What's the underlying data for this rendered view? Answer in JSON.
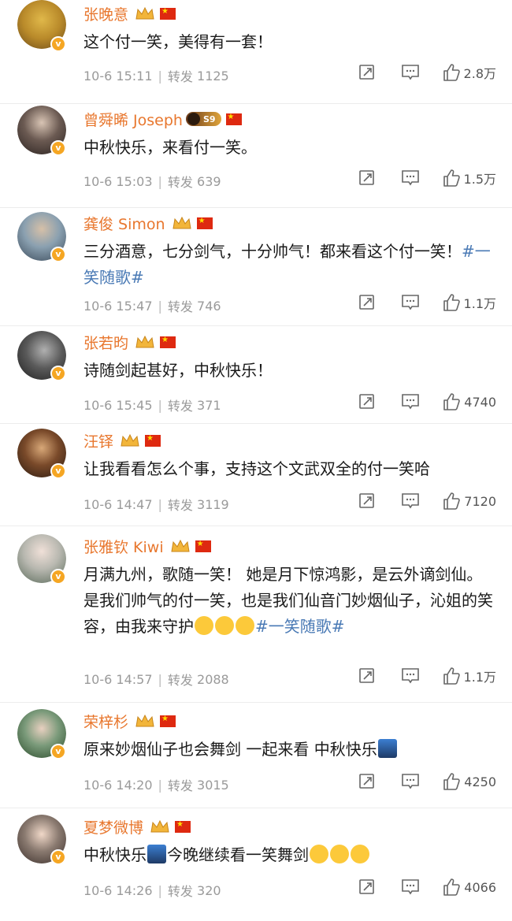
{
  "repost_label": "转发",
  "comments": [
    {
      "name": "张晚意",
      "text": "这个付一笑，美得有一套！",
      "tag": "",
      "time": "10-6 15:11",
      "reposts": "1125",
      "likes": "2.8万"
    },
    {
      "name": "曾舜晞 Joseph",
      "badge": "S9",
      "text": "中秋快乐，来看付一笑。",
      "tag": "",
      "time": "10-6 15:03",
      "reposts": "639",
      "likes": "1.5万"
    },
    {
      "name": "龚俊 Simon",
      "text": "三分酒意，七分剑气，十分帅气！都来看这个付一笑！",
      "tag": "#一笑随歌#",
      "time": "10-6 15:47",
      "reposts": "746",
      "likes": "1.1万"
    },
    {
      "name": "张若昀",
      "text": "诗随剑起甚好，中秋快乐！",
      "tag": "",
      "time": "10-6 15:45",
      "reposts": "371",
      "likes": "4740"
    },
    {
      "name": "汪铎",
      "text": "让我看看怎么个事，支持这个文武双全的付一笑哈",
      "tag": "",
      "time": "10-6 14:47",
      "reposts": "3119",
      "likes": "7120"
    },
    {
      "name": "张雅钦 Kiwi",
      "text": "月满九州，歌随一笑！ 她是月下惊鸿影，是云外谪剑仙。 是我们帅气的付一笑，也是我们仙音门妙烟仙子，沁姐的笑容，由我来守护",
      "tag": "#一笑随歌#",
      "time": "10-6 14:57",
      "reposts": "2088",
      "likes": "1.1万"
    },
    {
      "name": "荣梓杉",
      "text": "原来妙烟仙子也会舞剑 一起来看 中秋快乐",
      "tag": "",
      "time": "10-6 14:20",
      "reposts": "3015",
      "likes": "4250"
    },
    {
      "name": "夏梦微博",
      "text_a": "中秋快乐",
      "text_b": "今晚继续看一笑舞剑",
      "tag": "",
      "time": "10-6 14:26",
      "reposts": "320",
      "likes": "4066"
    }
  ]
}
